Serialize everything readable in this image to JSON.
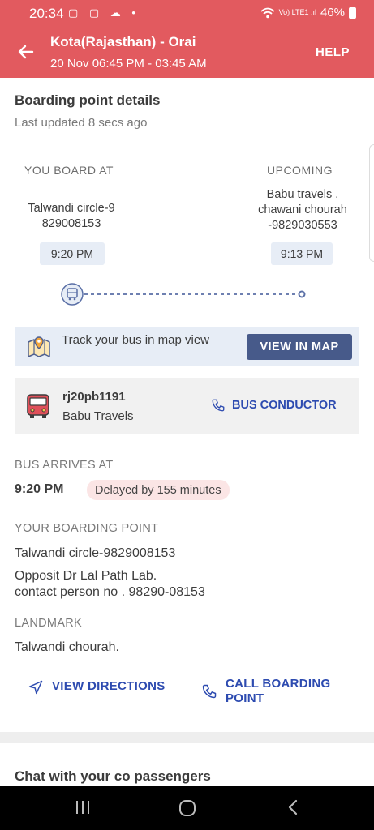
{
  "status_bar": {
    "time": "20:34",
    "left_icons": "▢ ▢ ☁ •",
    "network": "Vo) LTE1 .ıl",
    "battery": "46%"
  },
  "header": {
    "route": "Kota(Rajasthan) - Orai",
    "datetime": "20 Nov 06:45 PM - 03:45 AM",
    "help_label": "HELP"
  },
  "boarding": {
    "title": "Boarding point details",
    "last_updated": "Last updated 8 secs ago",
    "you_board": {
      "heading": "YOU BOARD AT",
      "line1": "Talwandi circle-9",
      "line2": "829008153",
      "time": "9:20 PM"
    },
    "upcoming": {
      "heading": "UPCOMING",
      "line1": "Babu travels ,",
      "line2": "chawani chourah",
      "line3": "-9829030553",
      "time": "9:13 PM"
    }
  },
  "map_card": {
    "text": "Track your bus in map view",
    "button": "VIEW IN MAP"
  },
  "bus": {
    "number": "rj20pb1191",
    "operator": "Babu Travels",
    "conductor_label": "BUS CONDUCTOR"
  },
  "arrival": {
    "label": "BUS ARRIVES AT",
    "time": "9:20 PM",
    "delay": "Delayed by 155 minutes"
  },
  "boarding_point": {
    "label": "YOUR BOARDING POINT",
    "name": "Talwandi circle-9829008153",
    "address_line1": "Opposit Dr Lal Path Lab.",
    "address_line2": "contact person no . 98290-08153"
  },
  "landmark": {
    "label": "LANDMARK",
    "value": "Talwandi chourah."
  },
  "actions": {
    "directions": "VIEW DIRECTIONS",
    "call_line1": "CALL BOARDING",
    "call_line2": "POINT"
  },
  "chat": {
    "title": "Chat with your co passengers"
  },
  "colors": {
    "header": "#e25a5f",
    "accent_blue": "#2d4bb0",
    "button_bg": "#475a8a",
    "card_bg": "#e7edf6",
    "delay_pill": "#fbe5e5"
  },
  "icons": {
    "back": "arrow-left-icon",
    "map": "map-pin-icon",
    "bus": "bus-icon",
    "phone": "phone-icon",
    "navigate": "navigation-arrow-icon"
  }
}
